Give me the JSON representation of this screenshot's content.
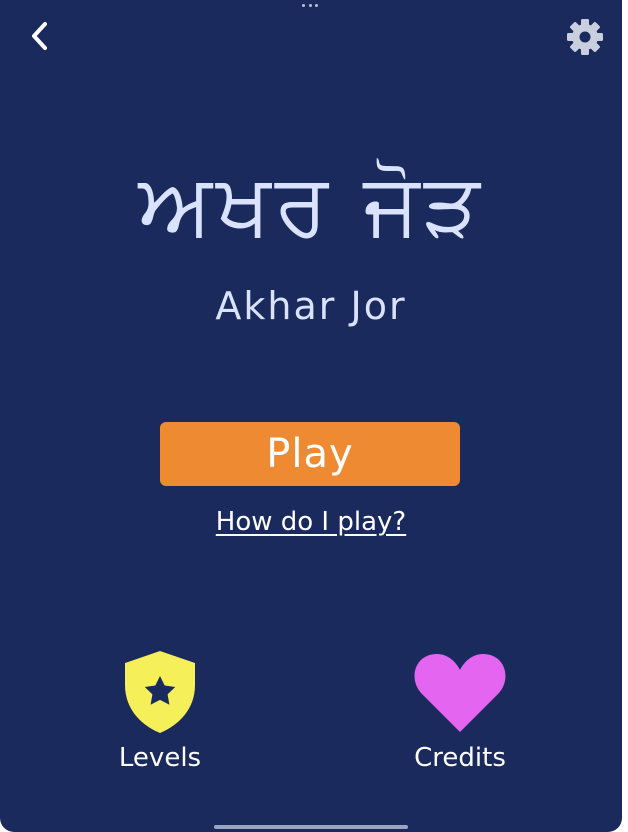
{
  "header": {
    "back_icon": "chevron-left-icon",
    "settings_icon": "gear-icon"
  },
  "title": {
    "gurmukhi": "ਅਖਰ ਜੋੜ",
    "latin": "Akhar Jor"
  },
  "actions": {
    "play_label": "Play",
    "how_to_label": "How do I play?"
  },
  "menu": {
    "levels": {
      "label": "Levels",
      "icon": "shield-star-icon"
    },
    "credits": {
      "label": "Credits",
      "icon": "heart-icon"
    }
  },
  "colors": {
    "background": "#1b2a5c",
    "play_button": "#ee8a32",
    "levels_icon": "#f5f05a",
    "credits_icon": "#e365f0",
    "title_text": "#d9e2ff"
  }
}
